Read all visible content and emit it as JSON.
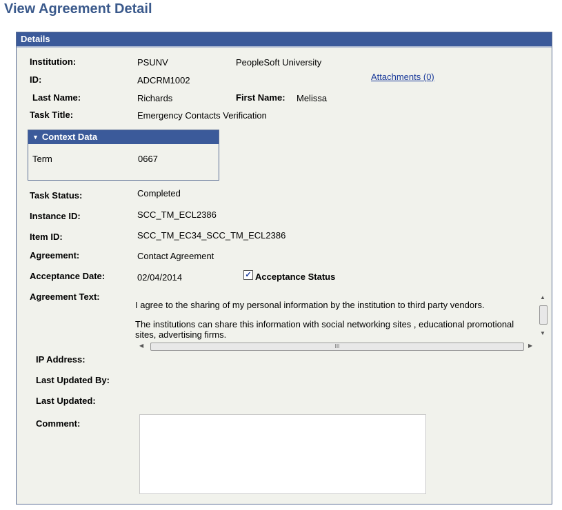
{
  "page": {
    "title": "View Agreement Detail"
  },
  "details": {
    "header": "Details",
    "institution_label": "Institution:",
    "institution_code": "PSUNV",
    "institution_name": "PeopleSoft University",
    "id_label": "ID:",
    "id_value": "ADCRM1002",
    "attachments_link": "Attachments (0)",
    "last_name_label": "Last Name:",
    "last_name_value": "Richards",
    "first_name_label": "First Name:",
    "first_name_value": "Melissa",
    "task_title_label": "Task Title:",
    "task_title_value": "Emergency Contacts Verification",
    "context": {
      "header": "Context Data",
      "term_label": "Term",
      "term_value": "0667"
    },
    "task_status_label": "Task Status:",
    "task_status_value": "Completed",
    "instance_id_label": "Instance ID:",
    "instance_id_value": "SCC_TM_ECL2386",
    "item_id_label": "Item ID:",
    "item_id_value": "SCC_TM_EC34_SCC_TM_ECL2386",
    "agreement_label": "Agreement:",
    "agreement_value": "Contact Agreement",
    "acceptance_date_label": "Acceptance Date:",
    "acceptance_date_value": "02/04/2014",
    "acceptance_status_label": "Acceptance Status",
    "acceptance_status_checked": true,
    "agreement_text_label": "Agreement Text:",
    "agreement_text_p1": "I agree to the sharing of my personal information by the institution to third party vendors.",
    "agreement_text_p2": "The institutions can share this information with social networking sites , educational promotional sites, advertising firms.",
    "ip_address_label": "IP Address:",
    "last_updated_by_label": "Last Updated By:",
    "last_updated_label": "Last Updated:",
    "comment_label": "Comment:",
    "comment_value": ""
  },
  "scrollbar": {
    "grip": "III"
  }
}
